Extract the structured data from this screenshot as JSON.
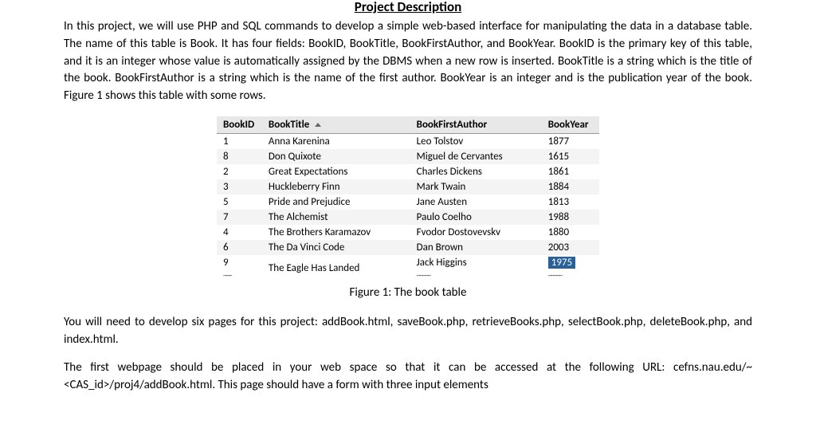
{
  "title": "Project Description",
  "para1": "In this project, we will use PHP and SQL commands to develop a simple web-based interface for manipulating the data in a database table. The name of this table is Book. It has four fields: BookID, BookTitle, BookFirstAuthor, and BookYear. BookID is the primary key of this table, and it is an integer whose value is automatically assigned by the DBMS when a new row is inserted. BookTitle is a string which is the title of the book. BookFirstAuthor is a string which is the name of the first author. BookYear is an integer and is the publication year of the book. Figure 1 shows this table with some rows.",
  "table": {
    "headers": {
      "id": "BookID",
      "title": "BookTitle",
      "author": "BookFirstAuthor",
      "year": "BookYear"
    },
    "rows": [
      {
        "id": "1",
        "title": "Anna Karenina",
        "author": "Leo Tolstov",
        "year": "1877"
      },
      {
        "id": "8",
        "title": "Don Quixote",
        "author": "Miguel de Cervantes",
        "year": "1615"
      },
      {
        "id": "2",
        "title": "Great Expectations",
        "author": "Charles Dickens",
        "year": "1861"
      },
      {
        "id": "3",
        "title": "Huckleberry Finn",
        "author": "Mark Twain",
        "year": "1884"
      },
      {
        "id": "5",
        "title": "Pride and Prejudice",
        "author": "Jane Austen",
        "year": "1813"
      },
      {
        "id": "7",
        "title": "The Alchemist",
        "author": "Paulo Coelho",
        "year": "1988"
      },
      {
        "id": "4",
        "title": "The Brothers Karamazov",
        "author": "Fvodor Dostovevskv",
        "year": "1880"
      },
      {
        "id": "6",
        "title": "The Da Vinci Code",
        "author": "Dan Brown",
        "year": "2003"
      },
      {
        "id": "9",
        "title": "The Eagle Has Landed",
        "author": "Jack Higgins",
        "year": "1975"
      }
    ]
  },
  "caption": "Figure 1: The book table",
  "para2": "You will need to develop six pages for this project: addBook.html, saveBook.php, retrieveBooks.php, selectBook.php, deleteBook.php, and index.html.",
  "para3": "The first webpage should be placed in your web space so that it can be accessed at the following URL: cefns.nau.edu/~<CAS_id>/proj4/addBook.html. This page should have a form with three input elements"
}
